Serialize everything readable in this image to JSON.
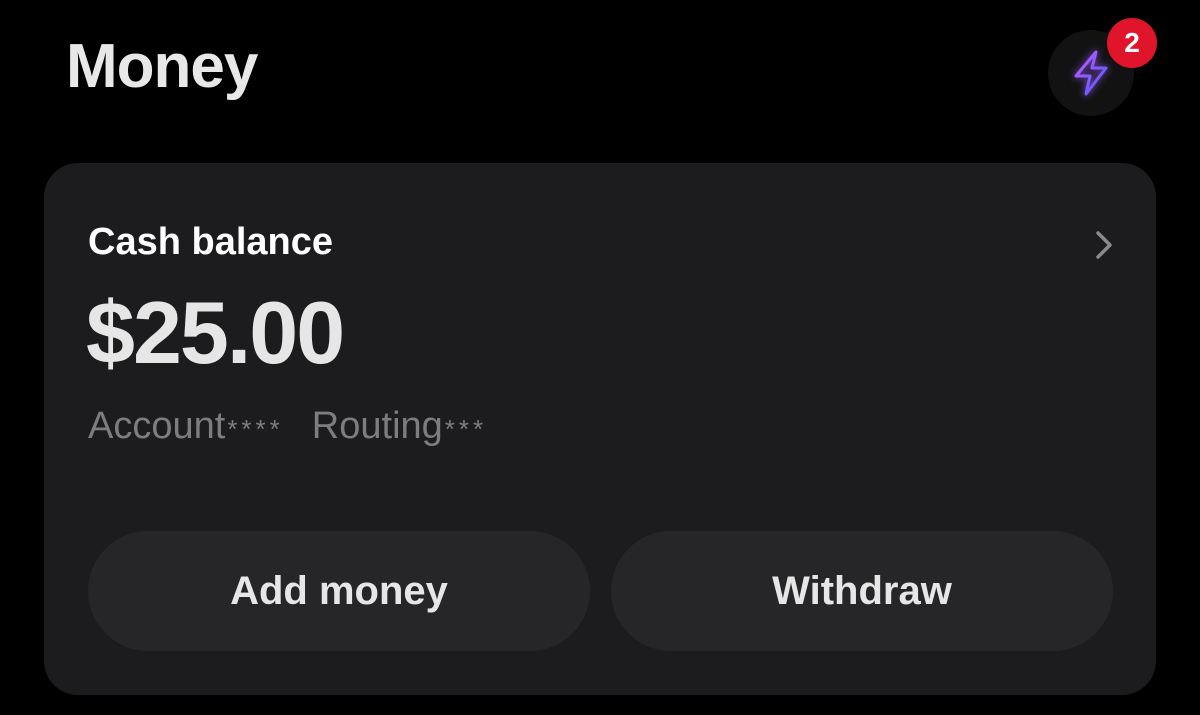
{
  "header": {
    "title": "Money",
    "boost_icon": "lightning-bolt-icon",
    "notification_count": "2"
  },
  "balance_card": {
    "label": "Cash balance",
    "amount": "$25.00",
    "account_label": "Account",
    "account_mask": "****",
    "routing_label": "Routing",
    "routing_mask": "***",
    "chevron_icon": "chevron-right-icon"
  },
  "actions": {
    "add_money_label": "Add money",
    "withdraw_label": "Withdraw"
  },
  "colors": {
    "background": "#000000",
    "card": "#1c1c1e",
    "button": "#262628",
    "badge": "#e0142b",
    "bolt_gradient_start": "#b04cff",
    "bolt_gradient_end": "#3d5bff",
    "muted_text": "#7d7d7f"
  }
}
